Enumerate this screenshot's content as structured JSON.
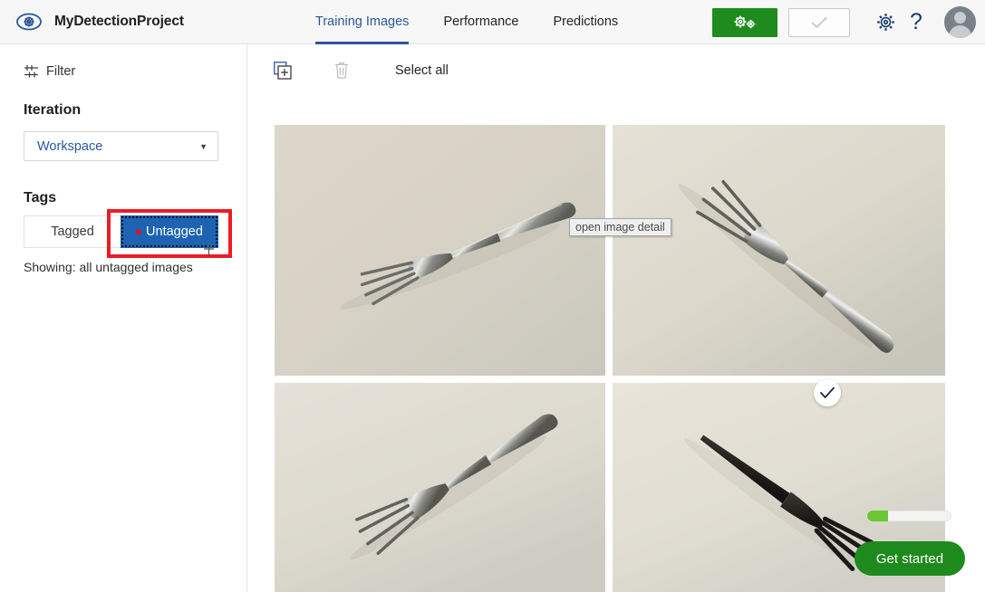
{
  "header": {
    "logo_icon": "eye-icon",
    "project_title": "MyDetectionProject",
    "tabs": [
      {
        "label": "Training Images",
        "active": true
      },
      {
        "label": "Performance",
        "active": false
      },
      {
        "label": "Predictions",
        "active": false
      }
    ],
    "train_button": {
      "icon": "gears-icon",
      "label": ""
    },
    "quick_test_button": {
      "icon": "checkmark-icon",
      "label": ""
    },
    "settings_icon": "gear-icon",
    "help_icon": "question-mark-icon",
    "avatar_icon": "user-avatar-icon",
    "accent_color": "#2b579a",
    "train_color": "#1f8b1f"
  },
  "sidebar": {
    "filter": {
      "label": "Filter",
      "icon": "filter-sliders-icon"
    },
    "iteration": {
      "heading": "Iteration",
      "selected": "Workspace",
      "caret": "▼"
    },
    "tags": {
      "heading": "Tags",
      "buttons": [
        {
          "label": "Tagged",
          "selected": false
        },
        {
          "label": "Untagged",
          "selected": true
        }
      ],
      "showing": "Showing: all untagged images",
      "selected_color": "#1d63b2",
      "dot_color": "#e81123"
    },
    "annotation": {
      "type": "red-rectangle",
      "color": "#ec1c24",
      "target": "Untagged"
    }
  },
  "toolbar": {
    "add_images_icon": "add-images-icon",
    "delete_icon": "trash-icon",
    "select_all_label": "Select all"
  },
  "gallery": {
    "tooltip": "open image detail",
    "selected_badge_icon": "checkmark-circle-icon",
    "images": [
      {
        "name": "fork-silver-diagonal-1",
        "alt": "silver fork, tines lower-left",
        "hovered": true
      },
      {
        "name": "fork-silver-diagonal-2",
        "alt": "silver fork, tines upper-left"
      },
      {
        "name": "fork-silver-diagonal-3",
        "alt": "silver fork, tines lower-left steep"
      },
      {
        "name": "fork-black-plastic",
        "alt": "black plastic fork"
      }
    ]
  },
  "footer_widget": {
    "progress_percent": 25,
    "progress_fill_color": "#6bc832",
    "get_started_label": "Get started",
    "get_started_color": "#1e8a1e"
  }
}
